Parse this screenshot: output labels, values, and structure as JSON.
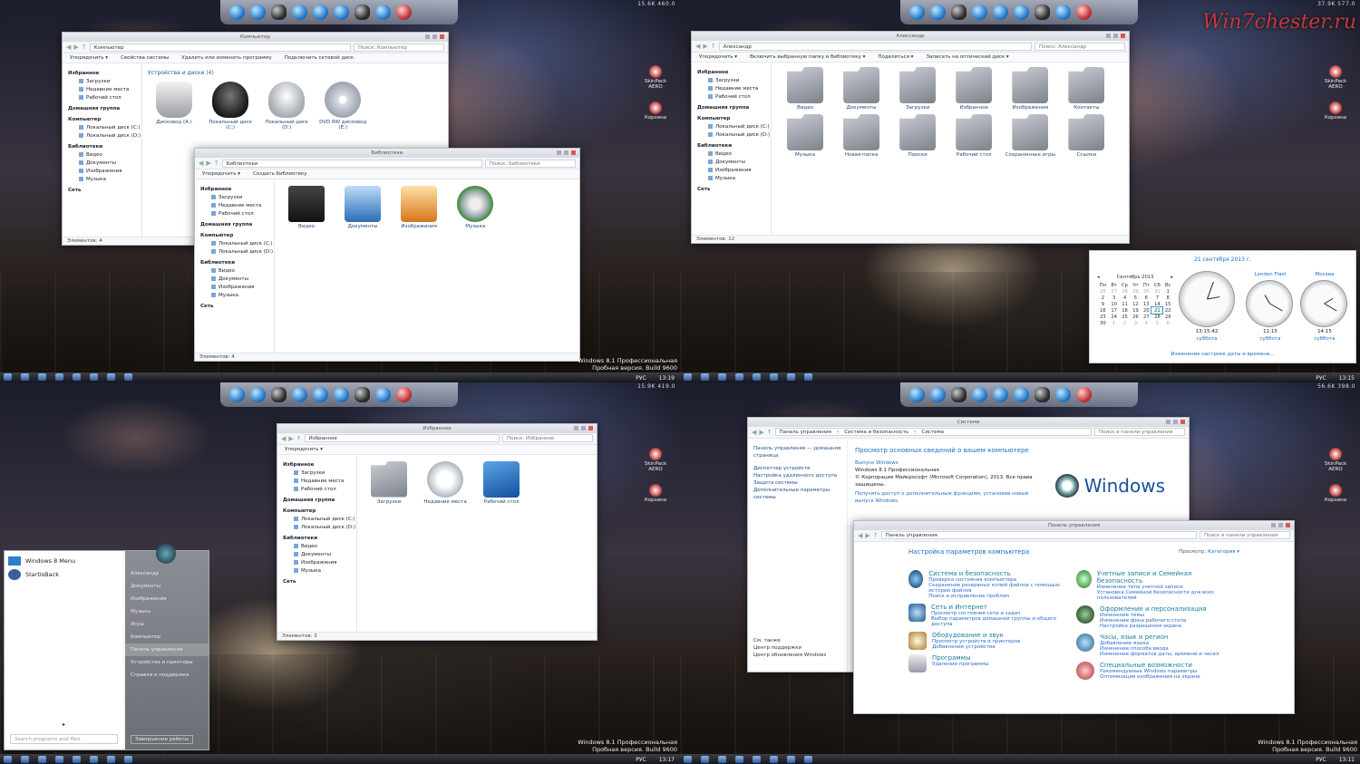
{
  "watermark": {
    "line1": "Windows 8.1 Профессиональная",
    "line2": "Пробная версия. Build 9600"
  },
  "site_logo": "Win7chester.ru",
  "q1": {
    "netstat": "15.6K   460.0",
    "computer_window": {
      "title": "Компьютер",
      "address": "Компьютер",
      "search": "Поиск: Компьютер",
      "commands": [
        "Упорядочить ▾",
        "Свойства системы",
        "Удалить или изменить программу",
        "Подключить сетевой диск"
      ],
      "group": "Устройства и диски (4)",
      "drives": [
        "Дисковод (A:)",
        "Локальный диск (C:)",
        "Локальный диск (D:)",
        "DVD RW дисковод (E:)"
      ],
      "status": "Элементов: 4"
    },
    "libraries_window": {
      "title": "Библиотеки",
      "address": "Библиотеки",
      "search": "Поиск: Библиотеки",
      "commands": [
        "Упорядочить ▾",
        "Создать библиотеку"
      ],
      "items": [
        "Видео",
        "Документы",
        "Изображения",
        "Музыка"
      ],
      "status": "Элементов: 4"
    },
    "sidebar": {
      "fav": "Избранное",
      "fav_items": [
        "Загрузки",
        "Недавние места",
        "Рабочий стол"
      ],
      "home": "Домашняя группа",
      "computer": "Компьютер",
      "comp_items": [
        "Локальный диск (C:)",
        "Локальный диск (D:)"
      ],
      "libs": "Библиотеки",
      "lib_items": [
        "Видео",
        "Документы",
        "Изображения",
        "Музыка"
      ],
      "net": "Сеть"
    },
    "tray": {
      "lang": "РУС",
      "time": "13:19"
    },
    "desk": [
      "SkinPack AERO",
      "Корзина"
    ]
  },
  "q2": {
    "netstat": "37.9K   577.0",
    "window": {
      "title": "Александр",
      "address": "Александр",
      "search": "Поиск: Александр",
      "commands": [
        "Упорядочить ▾",
        "Включить выбранную папку в библиотеку ▾",
        "Поделиться ▾",
        "Записать на оптический диск ▾"
      ],
      "items": [
        "Видео",
        "Документы",
        "Загрузки",
        "Избранное",
        "Изображения",
        "Контакты",
        "Музыка",
        "Новая папка",
        "Поиски",
        "Рабочий стол",
        "Сохраненные игры",
        "Ссылки"
      ],
      "status": "Элементов: 12"
    },
    "sidebar": {
      "fav": "Избранное",
      "fav_items": [
        "Загрузки",
        "Недавние места",
        "Рабочий стол"
      ],
      "home": "Домашняя группа",
      "computer": "Компьютер",
      "comp_items": [
        "Локальный диск (C:)",
        "Локальный диск (D:)"
      ],
      "libs": "Библиотеки",
      "lib_items": [
        "Видео",
        "Документы",
        "Изображения",
        "Музыка"
      ],
      "net": "Сеть"
    },
    "clock": {
      "date": "21 сентября 2013 г.",
      "month": "Сентябрь 2013",
      "weekdays": [
        "Пн",
        "Вт",
        "Ср",
        "Чт",
        "Пт",
        "Сб",
        "Вс"
      ],
      "weeks": [
        [
          "26",
          "27",
          "28",
          "29",
          "30",
          "31",
          "1"
        ],
        [
          "2",
          "3",
          "4",
          "5",
          "6",
          "7",
          "8"
        ],
        [
          "9",
          "10",
          "11",
          "12",
          "13",
          "14",
          "15"
        ],
        [
          "16",
          "17",
          "18",
          "19",
          "20",
          "21",
          "22"
        ],
        [
          "23",
          "24",
          "25",
          "26",
          "27",
          "28",
          "29"
        ],
        [
          "30",
          "1",
          "2",
          "3",
          "4",
          "5",
          "6"
        ]
      ],
      "clocks": [
        {
          "name": "",
          "time": "13:15:42",
          "day": "суббота"
        },
        {
          "name": "London Flast",
          "time": "11:15",
          "day": "суббота"
        },
        {
          "name": "Москва",
          "time": "14:15",
          "day": "суббота"
        }
      ],
      "link": "Изменение настроек даты и времени..."
    },
    "tray": {
      "lang": "РУС",
      "time": "13:15"
    },
    "desk": [
      "SkinPack AERO",
      "Корзина"
    ]
  },
  "q3": {
    "netstat": "15.9K   419.0",
    "window": {
      "title": "Избранное",
      "address": "Избранное",
      "search": "Поиск: Избранное",
      "commands": [
        "Упорядочить ▾"
      ],
      "items": [
        "Загрузки",
        "Недавние места",
        "Рабочий стол"
      ],
      "status": "Элементов: 3"
    },
    "sidebar": {
      "fav": "Избранное",
      "fav_items": [
        "Загрузки",
        "Недавние места",
        "Рабочий стол"
      ],
      "home": "Домашняя группа",
      "computer": "Компьютер",
      "comp_items": [
        "Локальный диск (C:)",
        "Локальный диск (D:)"
      ],
      "libs": "Библиотеки",
      "lib_items": [
        "Видео",
        "Документы",
        "Изображения",
        "Музыка"
      ],
      "net": "Сеть"
    },
    "start": {
      "items": [
        "Windows 8 Menu",
        "StartIsBack"
      ],
      "search": "Search programs and files",
      "right": [
        "Александр",
        "Документы",
        "Изображения",
        "Музыка",
        "Игры",
        "Компьютер",
        "Панель управления",
        "Устройства и принтеры",
        "Справка и поддержка"
      ],
      "shutdown": "Завершение работы"
    },
    "tray": {
      "lang": "РУС",
      "time": "13:17"
    },
    "desk": [
      "SkinPack AERO",
      "Корзина"
    ]
  },
  "q4": {
    "netstat": "56.6K   398.0",
    "system": {
      "title": "Система",
      "crumbs": [
        "Панель управления",
        "Система и безопасность",
        "Система"
      ],
      "search": "Поиск в панели управления",
      "left": [
        "Панель управления — домашняя страница",
        "Диспетчер устройств",
        "Настройка удаленного доступа",
        "Защита системы",
        "Дополнительные параметры системы"
      ],
      "heading": "Просмотр основных сведений о вашем компьютере",
      "edition_label": "Выпуск Windows",
      "edition": "Windows 8.1 Профессиональная",
      "copyright": "© Корпорация Майкрософт (Microsoft Corporation), 2013. Все права защищены.",
      "more": "Получить доступ к дополнительным функциям, установив новый выпуск Windows",
      "logo": "Windows",
      "see_also": [
        "См. также",
        "Центр поддержки",
        "Центр обновления Windows"
      ]
    },
    "panel": {
      "title": "Панель управления",
      "address": "Панель управления",
      "search": "Поиск в панели управления",
      "heading": "Настройка параметров компьютера",
      "view_label": "Просмотр:",
      "view": "Категория ▾",
      "left": [
        {
          "t": "Система и безопасность",
          "l": [
            "Проверка состояния компьютера",
            "Сохранение резервных копий файлов с помощью истории файлов",
            "Поиск и исправление проблем"
          ]
        },
        {
          "t": "Сеть и Интернет",
          "l": [
            "Просмотр состояния сети и задач",
            "Выбор параметров домашней группы и общего доступа"
          ]
        },
        {
          "t": "Оборудование и звук",
          "l": [
            "Просмотр устройств и принтеров",
            "Добавление устройства"
          ]
        },
        {
          "t": "Программы",
          "l": [
            "Удаление программы"
          ]
        }
      ],
      "right": [
        {
          "t": "Учетные записи и Семейная безопасность",
          "l": [
            "Изменение типа учетной записи",
            "Установка Семейной безопасности для всех пользователей"
          ]
        },
        {
          "t": "Оформление и персонализация",
          "l": [
            "Изменение темы",
            "Изменение фона рабочего стола",
            "Настройка разрешения экрана"
          ]
        },
        {
          "t": "Часы, язык и регион",
          "l": [
            "Добавление языка",
            "Изменение способа ввода",
            "Изменение форматов даты, времени и чисел"
          ]
        },
        {
          "t": "Специальные возможности",
          "l": [
            "Рекомендуемые Windows параметры",
            "Оптимизация изображения на экране"
          ]
        }
      ]
    },
    "tray": {
      "lang": "РУС",
      "time": "13:11"
    },
    "desk": [
      "SkinPack AERO",
      "Корзина"
    ]
  }
}
